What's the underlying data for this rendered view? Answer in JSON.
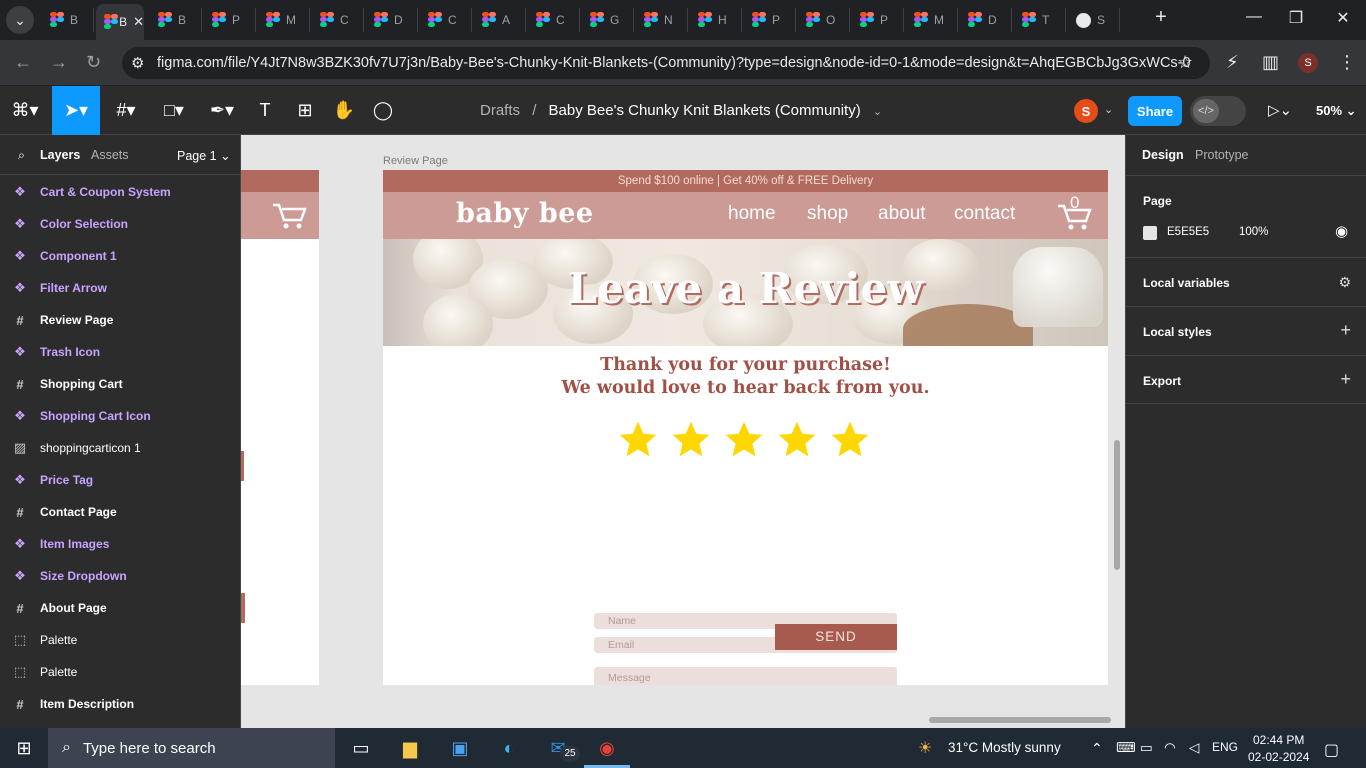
{
  "browser": {
    "tabs": [
      {
        "label": "B",
        "active": false
      },
      {
        "label": "B",
        "active": true
      },
      {
        "label": "B"
      },
      {
        "label": "P"
      },
      {
        "label": "M"
      },
      {
        "label": "C"
      },
      {
        "label": "D"
      },
      {
        "label": "C"
      },
      {
        "label": "A"
      },
      {
        "label": "C"
      },
      {
        "label": "G"
      },
      {
        "label": "N"
      },
      {
        "label": "H"
      },
      {
        "label": "P"
      },
      {
        "label": "O"
      },
      {
        "label": "P"
      },
      {
        "label": "M"
      },
      {
        "label": "D"
      },
      {
        "label": "T"
      },
      {
        "label": "S"
      }
    ],
    "new_tab": "+",
    "url": "figma.com/file/Y4Jt7N8w3BZK30fv7U7j3n/Baby-Bee's-Chunky-Knit-Blankets-(Community)?type=design&node-id=0-1&mode=design&t=AhqEGBCbJg3GxWCs-0",
    "profile_initial": "S"
  },
  "figma": {
    "breadcrumb_parent": "Drafts",
    "breadcrumb_sep": "/",
    "file_name": "Baby Bee's Chunky Knit Blankets (Community)",
    "avatar_initial": "S",
    "share_label": "Share",
    "zoom": "50%",
    "left_tabs": {
      "layers": "Layers",
      "assets": "Assets",
      "page": "Page 1"
    },
    "layers": [
      {
        "name": "Cart & Coupon System",
        "kind": "component",
        "icon": "component-icon"
      },
      {
        "name": "Color Selection",
        "kind": "component",
        "icon": "component-icon"
      },
      {
        "name": "Component 1",
        "kind": "component",
        "icon": "component-icon"
      },
      {
        "name": "Filter Arrow",
        "kind": "component",
        "icon": "component-icon"
      },
      {
        "name": "Review Page",
        "kind": "frame",
        "icon": "frame-icon"
      },
      {
        "name": "Trash Icon",
        "kind": "component",
        "icon": "component-icon"
      },
      {
        "name": "Shopping Cart",
        "kind": "frame",
        "icon": "frame-icon"
      },
      {
        "name": "Shopping Cart Icon",
        "kind": "component",
        "icon": "component-icon"
      },
      {
        "name": "shoppingcarticon 1",
        "kind": "image",
        "icon": "image-icon"
      },
      {
        "name": "Price Tag",
        "kind": "component",
        "icon": "component-icon"
      },
      {
        "name": "Contact Page",
        "kind": "frame",
        "icon": "frame-icon"
      },
      {
        "name": "Item Images",
        "kind": "component",
        "icon": "component-icon"
      },
      {
        "name": "Size Dropdown",
        "kind": "component",
        "icon": "component-icon"
      },
      {
        "name": "About Page",
        "kind": "frame",
        "icon": "frame-icon"
      },
      {
        "name": "Palette",
        "kind": "section",
        "icon": "section-icon"
      },
      {
        "name": "Palette",
        "kind": "section",
        "icon": "section-icon"
      },
      {
        "name": "Item Description",
        "kind": "frame",
        "icon": "frame-icon"
      }
    ],
    "right_tabs": {
      "design": "Design",
      "prototype": "Prototype"
    },
    "page_section": {
      "title": "Page",
      "color_hex": "E5E5E5",
      "opacity": "100%",
      "swatch": "#E5E5E5"
    },
    "sections": [
      "Local variables",
      "Local styles",
      "Export"
    ]
  },
  "design": {
    "frame_label": "Review Page",
    "promo": "Spend $100 online | Get 40% off & FREE Delivery",
    "logo": "baby bee",
    "nav": [
      "home",
      "shop",
      "about",
      "contact"
    ],
    "cart_count": "0",
    "hero_title": "Leave a Review",
    "thanks_line1": "Thank you for your purchase!",
    "thanks_line2": "We would love to hear back from you.",
    "rating": 5,
    "name_placeholder": "Name",
    "email_placeholder": "Email",
    "message_placeholder": "Message",
    "send_label": "SEND",
    "colors": {
      "promo": "#B36A5E",
      "nav": "#CC9B95",
      "accent": "#A24F45",
      "star": "#FFD700"
    }
  },
  "taskbar": {
    "search_placeholder": "Type here to search",
    "mail_badge": "25",
    "weather": "31°C  Mostly sunny",
    "lang": "ENG",
    "time": "02:44 PM",
    "date": "02-02-2024"
  }
}
